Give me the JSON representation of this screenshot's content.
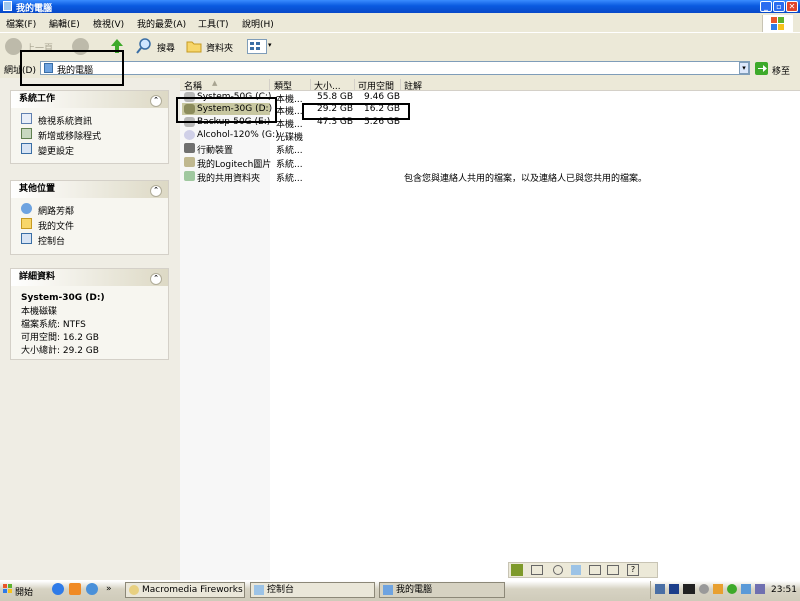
{
  "window": {
    "title": "我的電腦",
    "buttons": {
      "minimize": "_",
      "restore": "▫",
      "close": "✕"
    }
  },
  "menu": [
    "檔案(F)",
    "編輯(E)",
    "檢視(V)",
    "我的最愛(A)",
    "工具(T)",
    "說明(H)"
  ],
  "toolbar": {
    "back_label": "上一頁",
    "search_label": "搜尋",
    "folders_label": "資料夾"
  },
  "address": {
    "label": "網址(D)",
    "value": "我的電腦",
    "go_label": "移至"
  },
  "left_pane": {
    "system_tasks": {
      "title": "系統工作",
      "items": [
        "檢視系統資訊",
        "新增或移除程式",
        "變更設定"
      ]
    },
    "other_places": {
      "title": "其他位置",
      "items": [
        "網路芳鄰",
        "我的文件",
        "控制台"
      ]
    },
    "details": {
      "title": "詳細資料",
      "name": "System-30G (D:)",
      "type": "本機磁碟",
      "filesystem": "檔案系統: NTFS",
      "free": "可用空間: 16.2 GB",
      "total": "大小總計: 29.2 GB"
    }
  },
  "columns": [
    "名稱",
    "類型",
    "大小...",
    "可用空間",
    "註解"
  ],
  "rows": [
    {
      "name": "System-50G (C:)",
      "type": "本機...",
      "size": "55.8 GB",
      "free": "9.46 GB",
      "comment": ""
    },
    {
      "name": "System-30G (D:)",
      "type": "本機...",
      "size": "29.2 GB",
      "free": "16.2 GB",
      "comment": ""
    },
    {
      "name": "Backup-50G (E:)",
      "type": "本機...",
      "size": "47.3 GB",
      "free": "5.26 GB",
      "comment": ""
    },
    {
      "name": "Alcohol-120% (G:)",
      "type": "光碟機",
      "size": "",
      "free": "",
      "comment": ""
    },
    {
      "name": "行動裝置",
      "type": "系統...",
      "size": "",
      "free": "",
      "comment": ""
    },
    {
      "name": "我的Logitech圖片",
      "type": "系統...",
      "size": "",
      "free": "",
      "comment": ""
    },
    {
      "name": "我的共用資料夾",
      "type": "系統...",
      "size": "",
      "free": "",
      "comment": "包含您與連絡人共用的檔案，以及連絡人已與您共用的檔案。"
    }
  ],
  "taskbar": {
    "start_label": "開始",
    "tasks": [
      "Macromedia Fireworks M...",
      "控制台",
      "我的電腦"
    ],
    "clock": "23:51"
  },
  "colors": {
    "titlebar": "#0A5AE0",
    "selection": "#C8C7A0",
    "callout": "#000000"
  }
}
